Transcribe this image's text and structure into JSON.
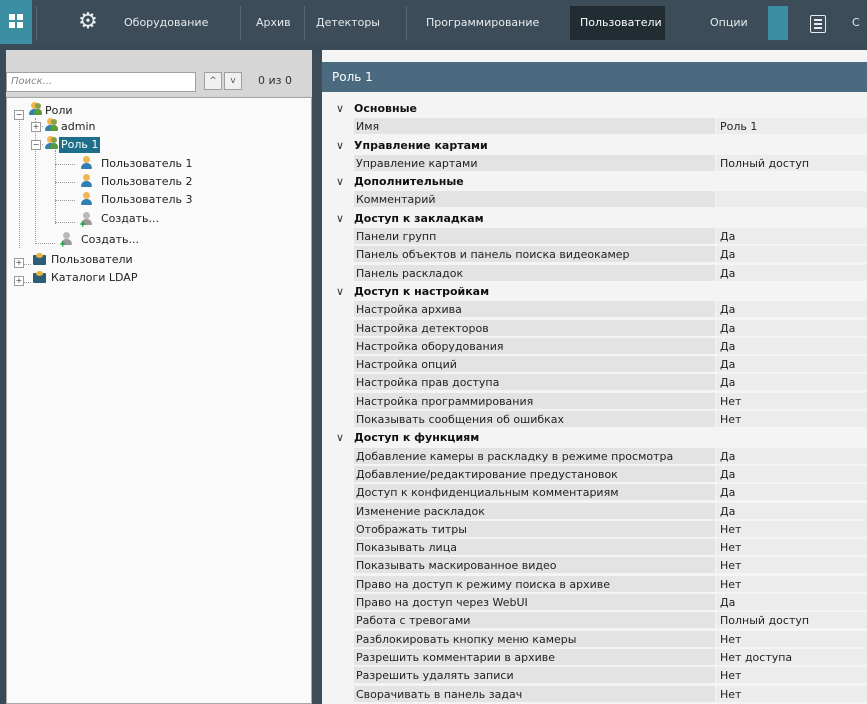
{
  "topbar": {
    "items": [
      {
        "label": "Оборудование"
      },
      {
        "label": "Архив"
      },
      {
        "label": "Детекторы"
      },
      {
        "label": "Программирование"
      },
      {
        "label": "Пользователи"
      },
      {
        "label": "Опции"
      }
    ],
    "cut_label": "С",
    "colors": {
      "bar": "#3c4d59",
      "accent": "#3a8fa3",
      "active": "#222c33"
    }
  },
  "left": {
    "search_placeholder": "Поиск...",
    "counter": "0 из 0",
    "tree": {
      "roles_label": "Роли",
      "admin_label": "admin",
      "role1_label": "Роль 1",
      "users": [
        "Пользователь 1",
        "Пользователь 2",
        "Пользователь 3"
      ],
      "create_user_label": "Создать...",
      "create_role_label": "Создать...",
      "users_group_label": "Пользователи",
      "ldap_label": "Каталоги LDAP"
    }
  },
  "right": {
    "title": "Роль 1",
    "sections": [
      {
        "title": "Основные",
        "rows": [
          [
            "Имя",
            "Роль 1"
          ]
        ]
      },
      {
        "title": "Управление картами",
        "rows": [
          [
            "Управление картами",
            "Полный доступ"
          ]
        ]
      },
      {
        "title": "Дополнительные",
        "rows": [
          [
            "Комментарий",
            ""
          ]
        ]
      },
      {
        "title": "Доступ к закладкам",
        "rows": [
          [
            "Панели групп",
            "Да"
          ],
          [
            "Панель объектов и панель поиска видеокамер",
            "Да"
          ],
          [
            "Панель раскладок",
            "Да"
          ]
        ]
      },
      {
        "title": "Доступ к настройкам",
        "rows": [
          [
            "Настройка архива",
            "Да"
          ],
          [
            "Настройка детекторов",
            "Да"
          ],
          [
            "Настройка оборудования",
            "Да"
          ],
          [
            "Настройка опций",
            "Да"
          ],
          [
            "Настройка прав доступа",
            "Да"
          ],
          [
            "Настройка программирования",
            "Нет"
          ],
          [
            "Показывать сообщения об ошибках",
            "Нет"
          ]
        ]
      },
      {
        "title": "Доступ к функциям",
        "rows": [
          [
            "Добавление камеры в раскладку в режиме просмотра",
            "Да"
          ],
          [
            "Добавление/редактирование предустановок",
            "Да"
          ],
          [
            "Доступ к конфиденциальным комментариям",
            "Да"
          ],
          [
            "Изменение раскладок",
            "Да"
          ],
          [
            "Отображать титры",
            "Нет"
          ],
          [
            "Показывать лица",
            "Нет"
          ],
          [
            "Показывать маскированное видео",
            "Нет"
          ],
          [
            "Право на доступ к режиму поиска в архиве",
            "Нет"
          ],
          [
            "Право на доступ через WebUI",
            "Да"
          ],
          [
            "Работа с тревогами",
            "Полный доступ"
          ],
          [
            "Разблокировать кнопку меню камеры",
            "Нет"
          ],
          [
            "Разрешить комментарии в архиве",
            "Нет доступа"
          ],
          [
            "Разрешить удалять записи",
            "Нет"
          ],
          [
            "Сворачивать в панель задач",
            "Нет"
          ]
        ]
      }
    ]
  }
}
